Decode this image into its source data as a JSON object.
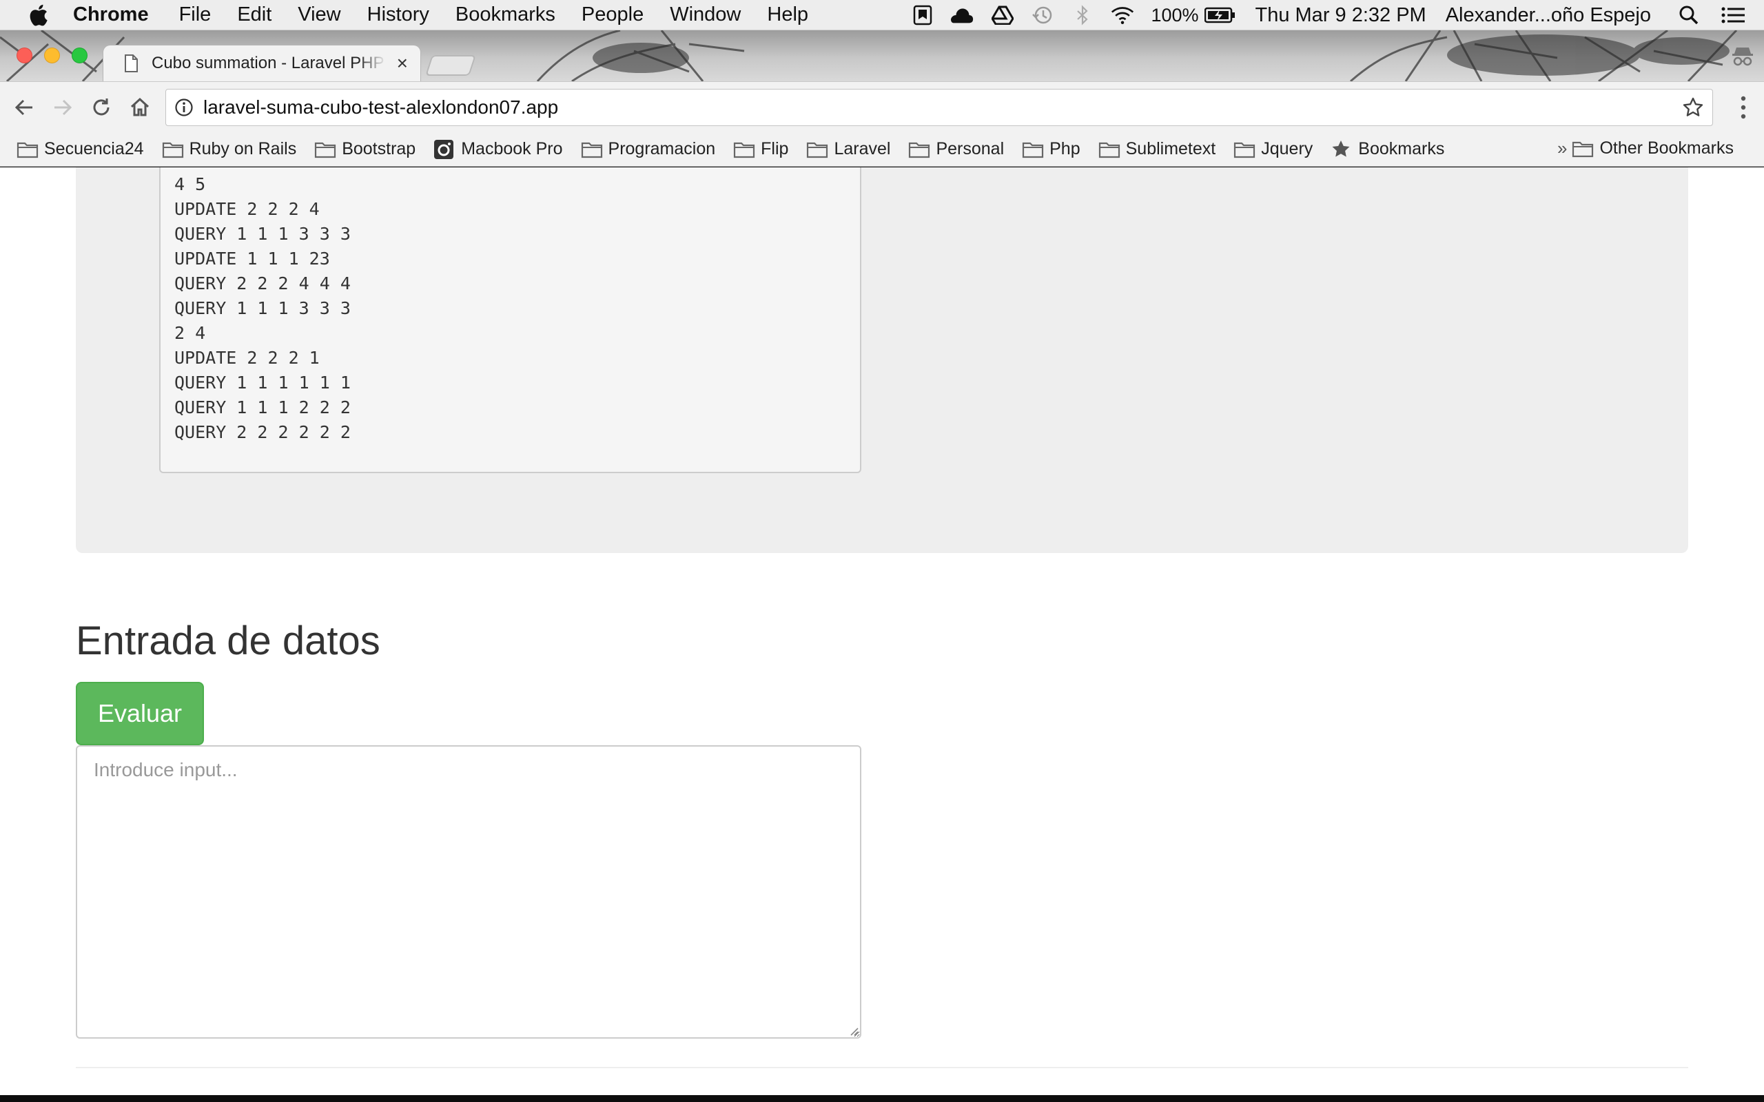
{
  "menubar": {
    "app_name": "Chrome",
    "items": [
      "File",
      "Edit",
      "View",
      "History",
      "Bookmarks",
      "People",
      "Window",
      "Help"
    ],
    "battery": "100%",
    "datetime": "Thu Mar 9  2:32 PM",
    "user": "Alexander...oño Espejo",
    "status_icons": [
      "bookmark-app-icon",
      "cloud-icon",
      "drive-icon",
      "time-machine-icon",
      "bluetooth-icon",
      "wifi-icon",
      "battery-icon",
      "spotlight-search-icon",
      "notification-list-icon"
    ]
  },
  "tab": {
    "title": "Cubo summation - Laravel PHP",
    "close_glyph": "×"
  },
  "toolbar": {
    "url": "laravel-suma-cubo-test-alexlondon07.app"
  },
  "bookmarks": {
    "items": [
      {
        "label": "Secuencia24",
        "icon": "folder-icon"
      },
      {
        "label": "Ruby on Rails",
        "icon": "folder-icon"
      },
      {
        "label": "Bootstrap",
        "icon": "folder-icon"
      },
      {
        "label": "Macbook Pro",
        "icon": "camera-icon"
      },
      {
        "label": "Programacion",
        "icon": "folder-icon"
      },
      {
        "label": "Flip",
        "icon": "folder-icon"
      },
      {
        "label": "Laravel",
        "icon": "folder-icon"
      },
      {
        "label": "Personal",
        "icon": "folder-icon"
      },
      {
        "label": "Php",
        "icon": "folder-icon"
      },
      {
        "label": "Sublimetext",
        "icon": "folder-icon"
      },
      {
        "label": "Jquery",
        "icon": "folder-icon"
      },
      {
        "label": "Bookmarks",
        "icon": "star-icon"
      }
    ],
    "overflow": "»",
    "other": "Other Bookmarks"
  },
  "example": {
    "lines": [
      "4 5",
      "UPDATE 2 2 2 4",
      "QUERY 1 1 1 3 3 3",
      "UPDATE 1 1 1 23",
      "QUERY 2 2 2 4 4 4",
      "QUERY 1 1 1 3 3 3",
      "2 4",
      "UPDATE 2 2 2 1",
      "QUERY 1 1 1 1 1 1",
      "QUERY 1 1 1 2 2 2",
      "QUERY 2 2 2 2 2 2"
    ]
  },
  "entrada": {
    "title": "Entrada de datos",
    "button_label": "Evaluar",
    "textarea_value": "",
    "textarea_placeholder": "Introduce input...",
    "button_color": "#5cb85c"
  }
}
